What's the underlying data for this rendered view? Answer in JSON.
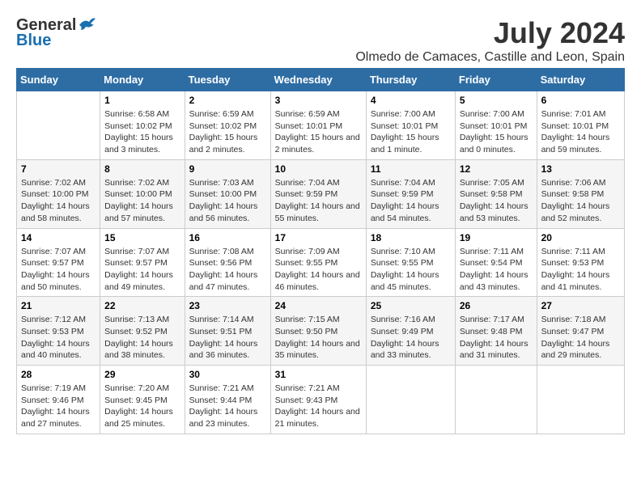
{
  "logo": {
    "general": "General",
    "blue": "Blue"
  },
  "title": "July 2024",
  "subtitle": "Olmedo de Camaces, Castille and Leon, Spain",
  "days_of_week": [
    "Sunday",
    "Monday",
    "Tuesday",
    "Wednesday",
    "Thursday",
    "Friday",
    "Saturday"
  ],
  "weeks": [
    [
      {
        "day": "",
        "sunrise": "",
        "sunset": "",
        "daylight": ""
      },
      {
        "day": "1",
        "sunrise": "Sunrise: 6:58 AM",
        "sunset": "Sunset: 10:02 PM",
        "daylight": "Daylight: 15 hours and 3 minutes."
      },
      {
        "day": "2",
        "sunrise": "Sunrise: 6:59 AM",
        "sunset": "Sunset: 10:02 PM",
        "daylight": "Daylight: 15 hours and 2 minutes."
      },
      {
        "day": "3",
        "sunrise": "Sunrise: 6:59 AM",
        "sunset": "Sunset: 10:01 PM",
        "daylight": "Daylight: 15 hours and 2 minutes."
      },
      {
        "day": "4",
        "sunrise": "Sunrise: 7:00 AM",
        "sunset": "Sunset: 10:01 PM",
        "daylight": "Daylight: 15 hours and 1 minute."
      },
      {
        "day": "5",
        "sunrise": "Sunrise: 7:00 AM",
        "sunset": "Sunset: 10:01 PM",
        "daylight": "Daylight: 15 hours and 0 minutes."
      },
      {
        "day": "6",
        "sunrise": "Sunrise: 7:01 AM",
        "sunset": "Sunset: 10:01 PM",
        "daylight": "Daylight: 14 hours and 59 minutes."
      }
    ],
    [
      {
        "day": "7",
        "sunrise": "Sunrise: 7:02 AM",
        "sunset": "Sunset: 10:00 PM",
        "daylight": "Daylight: 14 hours and 58 minutes."
      },
      {
        "day": "8",
        "sunrise": "Sunrise: 7:02 AM",
        "sunset": "Sunset: 10:00 PM",
        "daylight": "Daylight: 14 hours and 57 minutes."
      },
      {
        "day": "9",
        "sunrise": "Sunrise: 7:03 AM",
        "sunset": "Sunset: 10:00 PM",
        "daylight": "Daylight: 14 hours and 56 minutes."
      },
      {
        "day": "10",
        "sunrise": "Sunrise: 7:04 AM",
        "sunset": "Sunset: 9:59 PM",
        "daylight": "Daylight: 14 hours and 55 minutes."
      },
      {
        "day": "11",
        "sunrise": "Sunrise: 7:04 AM",
        "sunset": "Sunset: 9:59 PM",
        "daylight": "Daylight: 14 hours and 54 minutes."
      },
      {
        "day": "12",
        "sunrise": "Sunrise: 7:05 AM",
        "sunset": "Sunset: 9:58 PM",
        "daylight": "Daylight: 14 hours and 53 minutes."
      },
      {
        "day": "13",
        "sunrise": "Sunrise: 7:06 AM",
        "sunset": "Sunset: 9:58 PM",
        "daylight": "Daylight: 14 hours and 52 minutes."
      }
    ],
    [
      {
        "day": "14",
        "sunrise": "Sunrise: 7:07 AM",
        "sunset": "Sunset: 9:57 PM",
        "daylight": "Daylight: 14 hours and 50 minutes."
      },
      {
        "day": "15",
        "sunrise": "Sunrise: 7:07 AM",
        "sunset": "Sunset: 9:57 PM",
        "daylight": "Daylight: 14 hours and 49 minutes."
      },
      {
        "day": "16",
        "sunrise": "Sunrise: 7:08 AM",
        "sunset": "Sunset: 9:56 PM",
        "daylight": "Daylight: 14 hours and 47 minutes."
      },
      {
        "day": "17",
        "sunrise": "Sunrise: 7:09 AM",
        "sunset": "Sunset: 9:55 PM",
        "daylight": "Daylight: 14 hours and 46 minutes."
      },
      {
        "day": "18",
        "sunrise": "Sunrise: 7:10 AM",
        "sunset": "Sunset: 9:55 PM",
        "daylight": "Daylight: 14 hours and 45 minutes."
      },
      {
        "day": "19",
        "sunrise": "Sunrise: 7:11 AM",
        "sunset": "Sunset: 9:54 PM",
        "daylight": "Daylight: 14 hours and 43 minutes."
      },
      {
        "day": "20",
        "sunrise": "Sunrise: 7:11 AM",
        "sunset": "Sunset: 9:53 PM",
        "daylight": "Daylight: 14 hours and 41 minutes."
      }
    ],
    [
      {
        "day": "21",
        "sunrise": "Sunrise: 7:12 AM",
        "sunset": "Sunset: 9:53 PM",
        "daylight": "Daylight: 14 hours and 40 minutes."
      },
      {
        "day": "22",
        "sunrise": "Sunrise: 7:13 AM",
        "sunset": "Sunset: 9:52 PM",
        "daylight": "Daylight: 14 hours and 38 minutes."
      },
      {
        "day": "23",
        "sunrise": "Sunrise: 7:14 AM",
        "sunset": "Sunset: 9:51 PM",
        "daylight": "Daylight: 14 hours and 36 minutes."
      },
      {
        "day": "24",
        "sunrise": "Sunrise: 7:15 AM",
        "sunset": "Sunset: 9:50 PM",
        "daylight": "Daylight: 14 hours and 35 minutes."
      },
      {
        "day": "25",
        "sunrise": "Sunrise: 7:16 AM",
        "sunset": "Sunset: 9:49 PM",
        "daylight": "Daylight: 14 hours and 33 minutes."
      },
      {
        "day": "26",
        "sunrise": "Sunrise: 7:17 AM",
        "sunset": "Sunset: 9:48 PM",
        "daylight": "Daylight: 14 hours and 31 minutes."
      },
      {
        "day": "27",
        "sunrise": "Sunrise: 7:18 AM",
        "sunset": "Sunset: 9:47 PM",
        "daylight": "Daylight: 14 hours and 29 minutes."
      }
    ],
    [
      {
        "day": "28",
        "sunrise": "Sunrise: 7:19 AM",
        "sunset": "Sunset: 9:46 PM",
        "daylight": "Daylight: 14 hours and 27 minutes."
      },
      {
        "day": "29",
        "sunrise": "Sunrise: 7:20 AM",
        "sunset": "Sunset: 9:45 PM",
        "daylight": "Daylight: 14 hours and 25 minutes."
      },
      {
        "day": "30",
        "sunrise": "Sunrise: 7:21 AM",
        "sunset": "Sunset: 9:44 PM",
        "daylight": "Daylight: 14 hours and 23 minutes."
      },
      {
        "day": "31",
        "sunrise": "Sunrise: 7:21 AM",
        "sunset": "Sunset: 9:43 PM",
        "daylight": "Daylight: 14 hours and 21 minutes."
      },
      {
        "day": "",
        "sunrise": "",
        "sunset": "",
        "daylight": ""
      },
      {
        "day": "",
        "sunrise": "",
        "sunset": "",
        "daylight": ""
      },
      {
        "day": "",
        "sunrise": "",
        "sunset": "",
        "daylight": ""
      }
    ]
  ]
}
